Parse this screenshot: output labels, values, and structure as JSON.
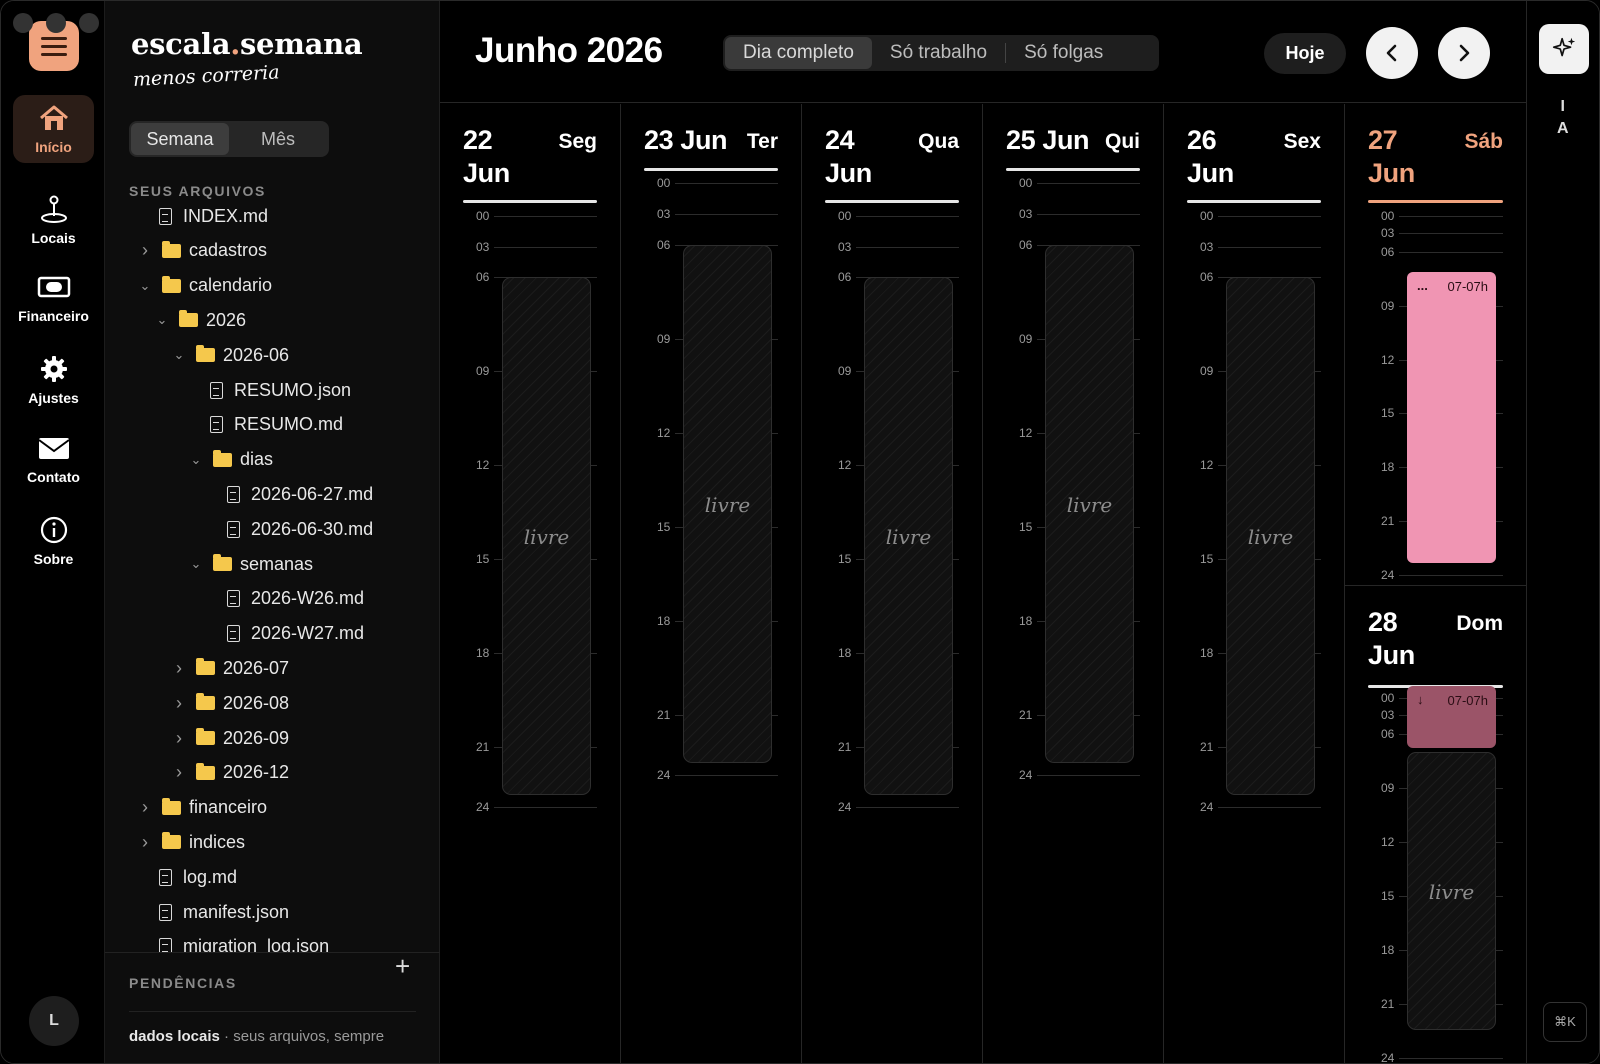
{
  "app": {
    "brand_left": "escala",
    "brand_dot": ".",
    "brand_right": "semana",
    "tagline": "menos correria"
  },
  "rail": {
    "items": [
      {
        "label": "Início",
        "icon": "home-icon",
        "active": true
      },
      {
        "label": "Locais",
        "icon": "map-pin-icon"
      },
      {
        "label": "Financeiro",
        "icon": "banknote-icon"
      },
      {
        "label": "Ajustes",
        "icon": "gear-icon"
      },
      {
        "label": "Contato",
        "icon": "mail-icon"
      },
      {
        "label": "Sobre",
        "icon": "info-icon"
      }
    ],
    "avatar": "L"
  },
  "sidebar": {
    "view_tabs": [
      "Semana",
      "Mês"
    ],
    "active_tab": "Semana",
    "files_title": "SEUS ARQUIVOS",
    "tree": [
      {
        "name": "INDEX.md",
        "type": "file",
        "depth": 0
      },
      {
        "name": "cadastros",
        "type": "folder",
        "depth": 0,
        "state": "collapsed"
      },
      {
        "name": "calendario",
        "type": "folder",
        "depth": 0,
        "state": "expanded"
      },
      {
        "name": "2026",
        "type": "folder",
        "depth": 1,
        "state": "expanded"
      },
      {
        "name": "2026-06",
        "type": "folder",
        "depth": 2,
        "state": "expanded"
      },
      {
        "name": "RESUMO.json",
        "type": "file",
        "depth": 3
      },
      {
        "name": "RESUMO.md",
        "type": "file",
        "depth": 3
      },
      {
        "name": "dias",
        "type": "folder",
        "depth": 3,
        "state": "expanded"
      },
      {
        "name": "2026-06-27.md",
        "type": "file",
        "depth": 4
      },
      {
        "name": "2026-06-30.md",
        "type": "file",
        "depth": 4
      },
      {
        "name": "semanas",
        "type": "folder",
        "depth": 3,
        "state": "expanded"
      },
      {
        "name": "2026-W26.md",
        "type": "file",
        "depth": 4
      },
      {
        "name": "2026-W27.md",
        "type": "file",
        "depth": 4
      },
      {
        "name": "2026-07",
        "type": "folder",
        "depth": 2,
        "state": "collapsed"
      },
      {
        "name": "2026-08",
        "type": "folder",
        "depth": 2,
        "state": "collapsed"
      },
      {
        "name": "2026-09",
        "type": "folder",
        "depth": 2,
        "state": "collapsed"
      },
      {
        "name": "2026-12",
        "type": "folder",
        "depth": 2,
        "state": "collapsed"
      },
      {
        "name": "financeiro",
        "type": "folder",
        "depth": 0,
        "state": "collapsed"
      },
      {
        "name": "indices",
        "type": "folder",
        "depth": 0,
        "state": "collapsed"
      },
      {
        "name": "log.md",
        "type": "file",
        "depth": 0
      },
      {
        "name": "manifest.json",
        "type": "file",
        "depth": 0
      },
      {
        "name": "migration_log.json",
        "type": "file",
        "depth": 0
      }
    ],
    "pending_title": "PENDÊNCIAS",
    "add_symbol": "+",
    "footer_bold": "dados locais",
    "footer_rest": " · seus arquivos, sempre"
  },
  "header": {
    "month_title": "Junho 2026",
    "filters": [
      "Dia completo",
      "Só trabalho",
      "Só folgas"
    ],
    "active_filter": "Dia completo",
    "today_label": "Hoje"
  },
  "calendar": {
    "hour_labels": [
      "00",
      "03",
      "06",
      "09",
      "12",
      "15",
      "18",
      "21",
      "24"
    ],
    "free_label": "livre",
    "days": [
      {
        "num": "22",
        "month": "Jun",
        "name": "Seg",
        "kind": "free"
      },
      {
        "num": "23",
        "month": "Jun",
        "name": "Ter",
        "kind": "free"
      },
      {
        "num": "24",
        "month": "Jun",
        "name": "Qua",
        "kind": "free"
      },
      {
        "num": "25",
        "month": "Jun",
        "name": "Qui",
        "kind": "free"
      },
      {
        "num": "26",
        "month": "Jun",
        "name": "Sex",
        "kind": "free"
      },
      {
        "num": "27",
        "month": "Jun",
        "name": "Sáb",
        "kind": "event",
        "event_time": "07-07h",
        "event_marker": "...",
        "event_color": "#f095b3"
      },
      {
        "num": "28",
        "month": "Jun",
        "name": "Dom",
        "kind": "event-free",
        "event_time": "07-07h",
        "event_marker": "↓",
        "event_color": "#9b5468"
      }
    ]
  },
  "right_rail": {
    "ia_letters": [
      "I",
      "A"
    ],
    "shortcut": "⌘K",
    "icon": "sparkles-icon"
  },
  "colors": {
    "accent": "#f0a37e",
    "folder": "#f5c84c",
    "event_pink": "#f095b3",
    "event_dim": "#9b5468"
  }
}
